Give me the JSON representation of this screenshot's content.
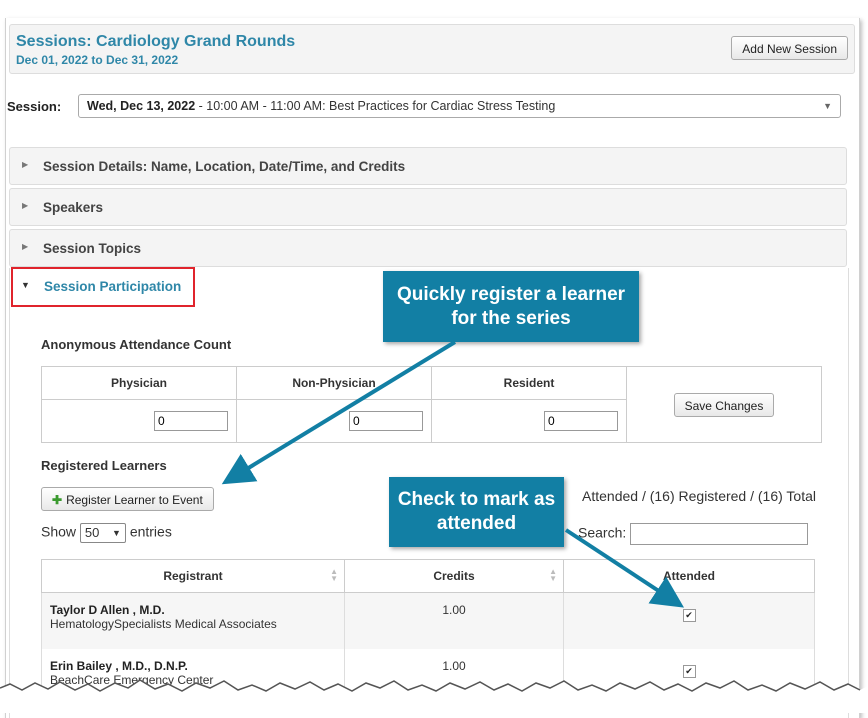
{
  "header": {
    "title": "Sessions: Cardiology Grand Rounds",
    "dates": "Dec 01, 2022 to Dec 31, 2022",
    "add_button": "Add New Session"
  },
  "session": {
    "label": "Session:",
    "selected_date": "Wed, Dec 13, 2022",
    "selected_rest": " - 10:00 AM - 11:00 AM: Best Practices for Cardiac Stress Testing"
  },
  "panels": [
    {
      "label": "Session Details: Name, Location, Date/Time, and Credits"
    },
    {
      "label": "Speakers"
    },
    {
      "label": "Session Topics"
    }
  ],
  "participation": {
    "label": "Session Participation",
    "anon_title": "Anonymous Attendance Count",
    "columns": [
      "Physician",
      "Non-Physician",
      "Resident"
    ],
    "values": [
      "0",
      "0",
      "0"
    ],
    "save_button": "Save Changes",
    "registered_title": "Registered Learners",
    "register_button": "Register Learner to Event",
    "show_prefix": "Show",
    "show_value": "50",
    "show_suffix": "entries",
    "summary": "Attended / (16) Registered / (16) Total",
    "search_label": "Search:",
    "table_headers": [
      "Registrant",
      "Credits",
      "Attended"
    ],
    "rows": [
      {
        "name": "Taylor D Allen , M.D.",
        "org": "HematologySpecialists Medical Associates",
        "credits": "1.00",
        "attended": true
      },
      {
        "name": "Erin Bailey , M.D., D.N.P.",
        "org": "BeachCare Emergency Center",
        "credits": "1.00",
        "attended": true
      }
    ]
  },
  "callouts": {
    "register": "Quickly register a learner for the series",
    "attended": "Check to mark as attended"
  },
  "colors": {
    "accent": "#2f87a8",
    "callout": "#127fa4",
    "highlight_border": "#e0242c"
  }
}
